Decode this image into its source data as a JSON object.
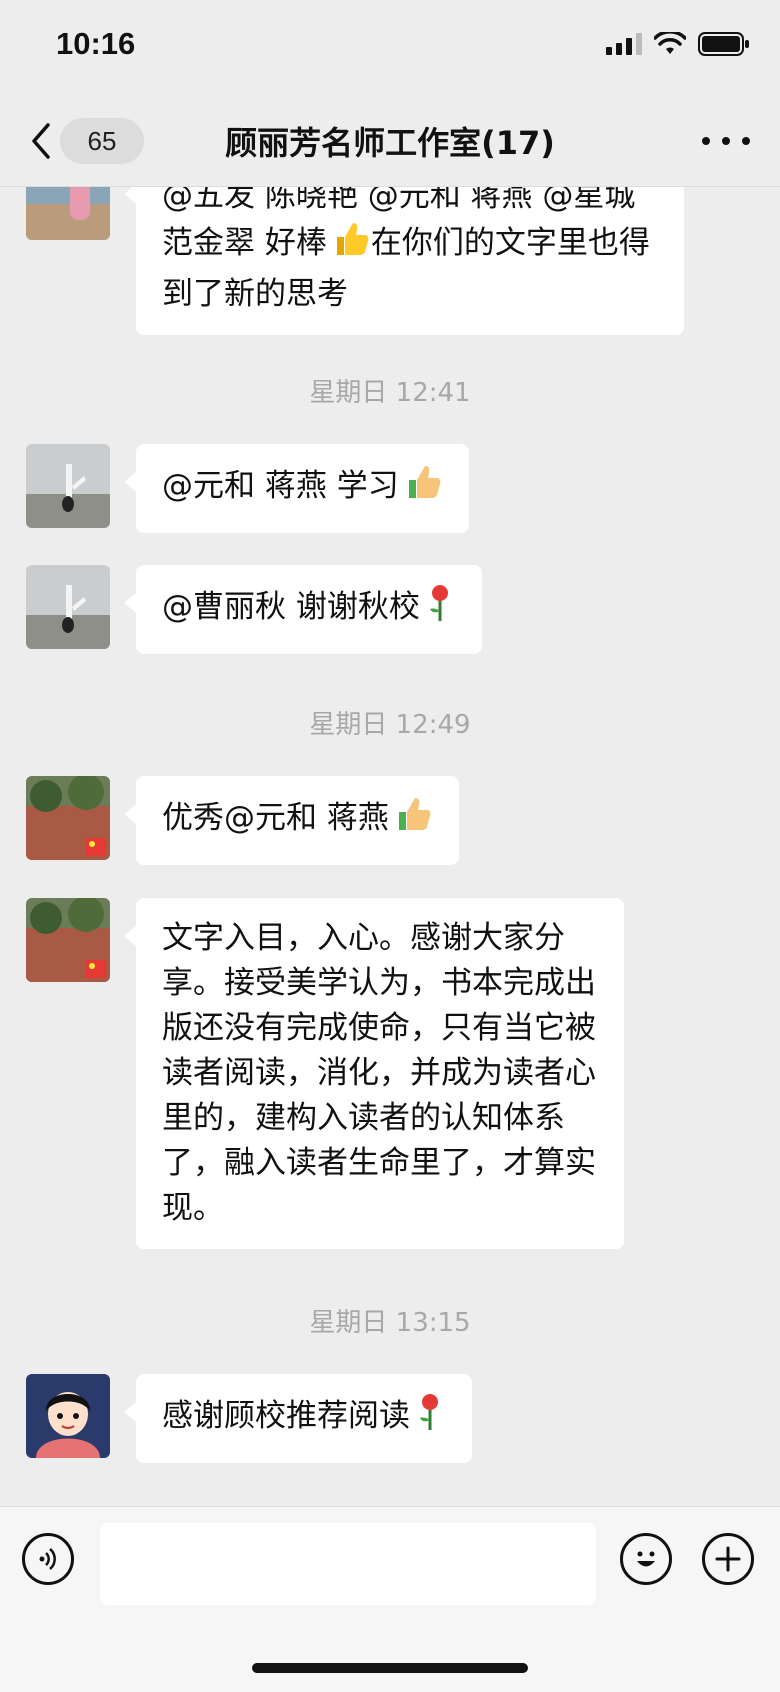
{
  "status_bar": {
    "time": "10:16"
  },
  "nav": {
    "unread_count": "65",
    "title": "顾丽芳名师工作室(17)"
  },
  "messages": [
    {
      "text": "@五发 陈晓艳 @元和 蒋燕 @星城 范金翠 好棒",
      "text_after_emoji": "在你们的文字里也得到了新的思考",
      "emoji": "thumbs-up"
    },
    {
      "timestamp": "星期日 12:41"
    },
    {
      "text": "@元和 蒋燕 学习",
      "emoji": "thumbs-up"
    },
    {
      "text": "@曹丽秋 谢谢秋校",
      "emoji": "rose"
    },
    {
      "timestamp": "星期日 12:49"
    },
    {
      "text": "优秀@元和 蒋燕",
      "emoji": "thumbs-up"
    },
    {
      "text": "文字入目，入心。感谢大家分享。接受美学认为，书本完成出版还没有完成使命，只有当它被读者阅读，消化，并成为读者心里的，建构入读者的认知体系了，融入读者生命里了，才算实现。"
    },
    {
      "timestamp": "星期日 13:15"
    },
    {
      "text": "感谢顾校推荐阅读",
      "emoji": "rose"
    }
  ],
  "input_bar": {
    "placeholder": ""
  },
  "icons": {
    "back": "chevron-left-icon",
    "more": "more-dots-icon",
    "voice": "voice-icon",
    "emoji": "emoji-face-icon",
    "plus": "plus-icon"
  }
}
